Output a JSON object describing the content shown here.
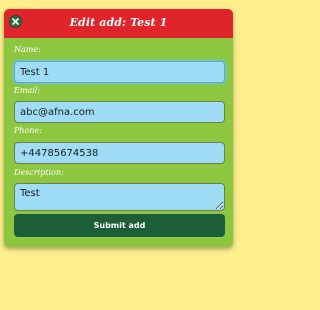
{
  "dialog": {
    "title": "Edit add: Test 1",
    "close_icon": "close-icon",
    "colors": {
      "page_background": "#fcef8c",
      "dialog_background": "#8dc63f",
      "header_background": "#e0242b",
      "input_background": "#9eddf5",
      "button_background": "#1b5e38"
    }
  },
  "form": {
    "name": {
      "label": "Name:",
      "value": "Test 1"
    },
    "email": {
      "label": "Email:",
      "value": "abc@afna.com"
    },
    "phone": {
      "label": "Phone:",
      "value": "+44785674538"
    },
    "description": {
      "label": "Description:",
      "value": "Test"
    },
    "submit_label": "Submit add"
  }
}
